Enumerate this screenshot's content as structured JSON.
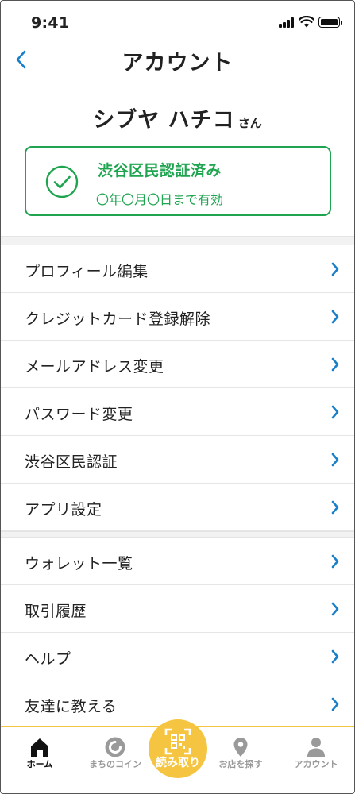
{
  "status_bar": {
    "time": "9:41"
  },
  "header": {
    "title": "アカウント"
  },
  "profile": {
    "name": "シブヤ ハチコ",
    "honorific": "さん"
  },
  "certification": {
    "title": "渋谷区民認証済み",
    "validity": "〇年〇月〇日まで有効"
  },
  "menu_group_1": [
    {
      "label": "プロフィール編集"
    },
    {
      "label": "クレジットカード登録解除"
    },
    {
      "label": "メールアドレス変更"
    },
    {
      "label": "パスワード変更"
    },
    {
      "label": "渋谷区民認証"
    },
    {
      "label": "アプリ設定"
    }
  ],
  "menu_group_2": [
    {
      "label": "ウォレット一覧"
    },
    {
      "label": "取引履歴"
    },
    {
      "label": "ヘルプ"
    },
    {
      "label": "友達に教える"
    }
  ],
  "tab_bar": {
    "home": "ホーム",
    "coin": "まちのコイン",
    "scan": "読み取り",
    "stores": "お店を探す",
    "account": "アカウント"
  },
  "colors": {
    "accent_blue": "#1a7fc9",
    "verified_green": "#1fa550",
    "tab_yellow": "#f5c542"
  },
  "icons": [
    "back-chevron-icon",
    "check-circle-icon",
    "chevron-right-icon",
    "home-icon",
    "coin-icon",
    "qr-scan-icon",
    "map-pin-icon",
    "user-icon"
  ]
}
